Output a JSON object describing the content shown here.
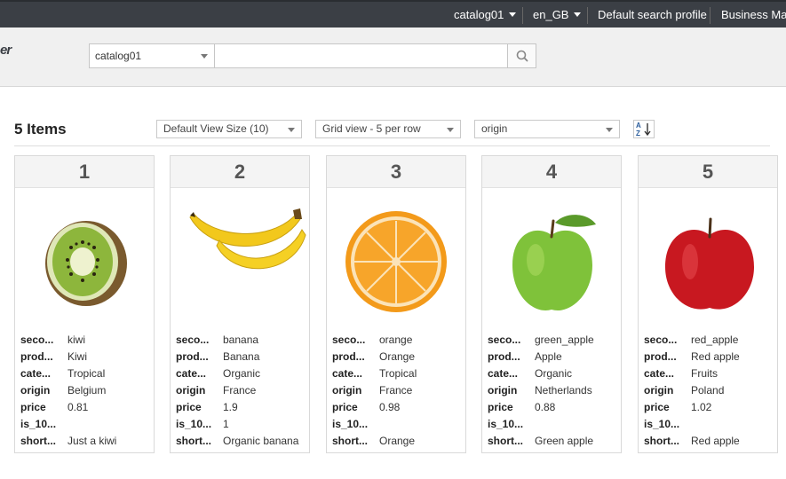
{
  "topbar": {
    "catalog": "catalog01",
    "locale": "en_GB",
    "search_profile": "Default search profile",
    "business": "Business Ma"
  },
  "header": {
    "logo_text": "er",
    "catalog_select": "catalog01",
    "search_value": "",
    "search_icon": "magnifier-icon"
  },
  "toolbar": {
    "count_label": "5 Items",
    "view_size": "Default View Size (10)",
    "grid_view": "Grid view - 5 per row",
    "sort_field": "origin",
    "sort_icon": "sort-az-icon"
  },
  "items": [
    {
      "rank": "1",
      "image": "kiwi",
      "fields": [
        [
          "seco...",
          "kiwi"
        ],
        [
          "prod...",
          "Kiwi"
        ],
        [
          "cate...",
          "Tropical"
        ],
        [
          "origin",
          "Belgium"
        ],
        [
          "price",
          "0.81"
        ],
        [
          "is_10...",
          ""
        ],
        [
          "short...",
          "Just a kiwi"
        ]
      ]
    },
    {
      "rank": "2",
      "image": "banana",
      "fields": [
        [
          "seco...",
          "banana"
        ],
        [
          "prod...",
          "Banana"
        ],
        [
          "cate...",
          "Organic"
        ],
        [
          "origin",
          "France"
        ],
        [
          "price",
          "1.9"
        ],
        [
          "is_10...",
          "1"
        ],
        [
          "short...",
          "Organic banana"
        ]
      ]
    },
    {
      "rank": "3",
      "image": "orange",
      "fields": [
        [
          "seco...",
          "orange"
        ],
        [
          "prod...",
          "Orange"
        ],
        [
          "cate...",
          "Tropical"
        ],
        [
          "origin",
          "France"
        ],
        [
          "price",
          "0.98"
        ],
        [
          "is_10...",
          ""
        ],
        [
          "short...",
          "Orange"
        ]
      ]
    },
    {
      "rank": "4",
      "image": "green_apple",
      "fields": [
        [
          "seco...",
          "green_apple"
        ],
        [
          "prod...",
          "Apple"
        ],
        [
          "cate...",
          "Organic"
        ],
        [
          "origin",
          "Netherlands"
        ],
        [
          "price",
          "0.88"
        ],
        [
          "is_10...",
          ""
        ],
        [
          "short...",
          "Green apple"
        ]
      ]
    },
    {
      "rank": "5",
      "image": "red_apple",
      "fields": [
        [
          "seco...",
          "red_apple"
        ],
        [
          "prod...",
          "Red apple"
        ],
        [
          "cate...",
          "Fruits"
        ],
        [
          "origin",
          "Poland"
        ],
        [
          "price",
          "1.02"
        ],
        [
          "is_10...",
          ""
        ],
        [
          "short...",
          "Red apple"
        ]
      ]
    }
  ]
}
